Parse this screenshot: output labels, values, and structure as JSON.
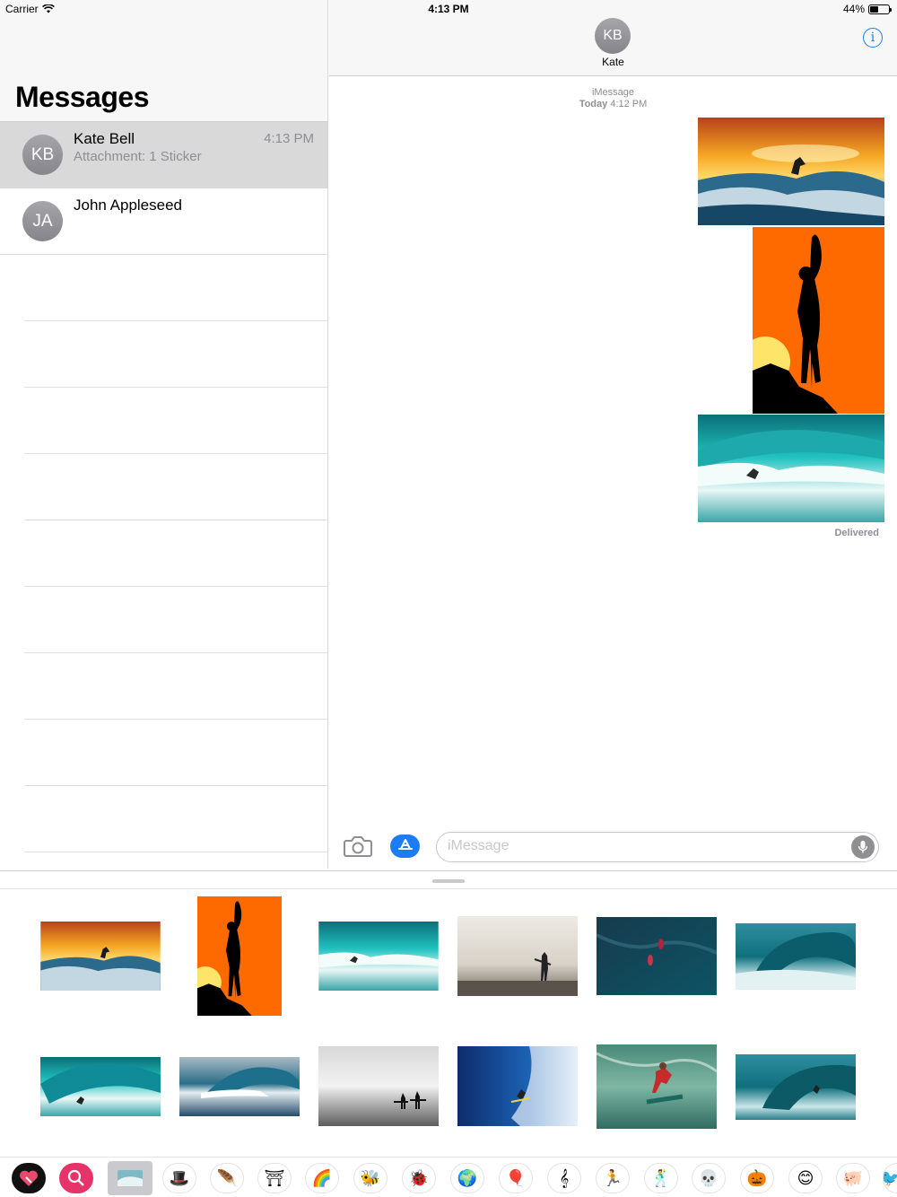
{
  "status": {
    "carrier": "Carrier",
    "time": "4:13 PM",
    "battery": "44%"
  },
  "sidebar": {
    "title": "Messages",
    "conversations": [
      {
        "initials": "KB",
        "name": "Kate Bell",
        "preview": "Attachment: 1 Sticker",
        "time": "4:13 PM"
      },
      {
        "initials": "JA",
        "name": "John Appleseed",
        "preview": "",
        "time": ""
      }
    ]
  },
  "chat": {
    "contact_initials": "KB",
    "contact_name": "Kate",
    "service": "iMessage",
    "today_label": "Today",
    "today_time": "4:12 PM",
    "delivered": "Delivered",
    "input_placeholder": "iMessage"
  },
  "drawer": {
    "stickers": [
      "sunset-surfer",
      "surfer-silhouette",
      "turquoise-wave",
      "misty-beach-surfer",
      "aerial-surfers",
      "barrel-wave",
      "tube-rider",
      "big-barrel",
      "beach-surfers",
      "blue-wave-surfer",
      "red-shirt-surfer",
      "teal-barrel"
    ],
    "apps": [
      "heart-app-icon",
      "search-app-icon",
      "surf-stickers-icon",
      "hat-icon",
      "feather-icon",
      "pyramid-icon",
      "rainbow-icon",
      "bee-icon",
      "ladybug-icon",
      "globe-icon",
      "balloon-icon",
      "treble-clef-icon",
      "runner-icon",
      "dancer-icon",
      "skeleton-icon",
      "pumpkin-icon",
      "smiley-icon",
      "pig-icon",
      "bird-icon"
    ]
  }
}
